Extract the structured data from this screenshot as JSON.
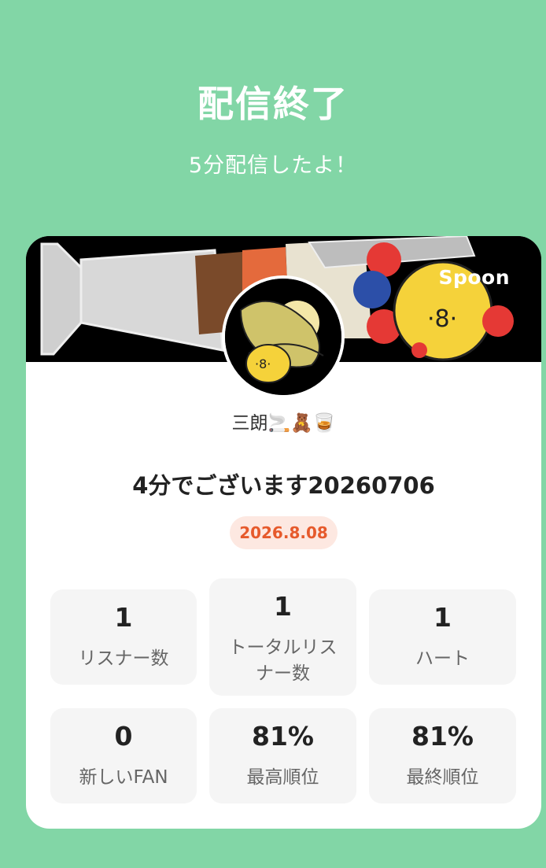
{
  "header": {
    "title": "配信終了",
    "subtitle": "5分配信したよ！"
  },
  "card": {
    "brand": "Spoon",
    "dj_name": "三朗🚬🧸🥃",
    "cast_title": "4分でございます20260706",
    "date": "2026.8.08",
    "stats": [
      {
        "value": "1",
        "label": "リスナー数"
      },
      {
        "value": "1",
        "label": "トータルリス\nナー数"
      },
      {
        "value": "1",
        "label": "ハート"
      },
      {
        "value": "0",
        "label": "新しいFAN"
      },
      {
        "value": "81%",
        "label": "最高順位"
      },
      {
        "value": "81%",
        "label": "最終順位"
      }
    ]
  },
  "colors": {
    "background": "#82d6a6",
    "date_badge_bg": "#fde8e1",
    "date_badge_text": "#e65a2c",
    "stat_bg": "#f5f5f5"
  }
}
